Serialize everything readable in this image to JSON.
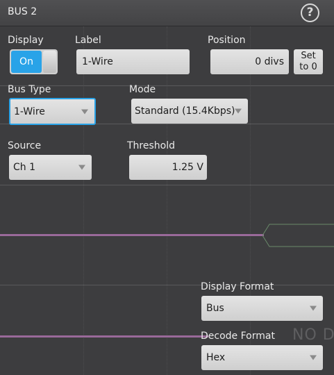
{
  "window": {
    "title": "BUS 2"
  },
  "display": {
    "label": "Display",
    "toggle_value": "On"
  },
  "label_field": {
    "label": "Label",
    "value": "1-Wire"
  },
  "position": {
    "label": "Position",
    "value": "0 divs",
    "set_button": "Set\nto 0"
  },
  "bus_type": {
    "label": "Bus Type",
    "value": "1-Wire"
  },
  "mode": {
    "label": "Mode",
    "value": "Standard (15.4Kbps)"
  },
  "source": {
    "label": "Source",
    "value": "Ch 1"
  },
  "threshold": {
    "label": "Threshold",
    "value": "1.25 V"
  },
  "display_format": {
    "label": "Display Format",
    "value": "Bus"
  },
  "decode_format": {
    "label": "Decode Format",
    "value": "Hex"
  },
  "background": {
    "no_data_text": "NO D"
  },
  "colors": {
    "accent": "#29a3e8",
    "trace": "#9a6a9a",
    "panel": "#3d3d3f"
  },
  "icons": {
    "help": "help-icon"
  }
}
